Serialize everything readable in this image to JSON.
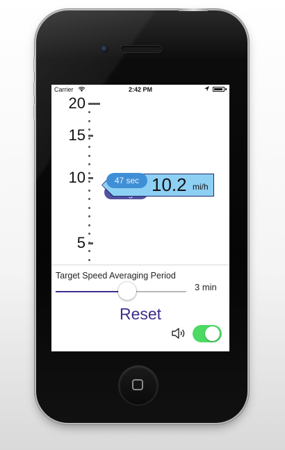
{
  "status_bar": {
    "carrier": "Carrier",
    "time": "2:42 PM",
    "battery_level": 0.9
  },
  "gauge": {
    "ticks": [
      "20",
      "15",
      "10",
      "5"
    ],
    "current_speed": "10.2",
    "speed_unit": "mi/h",
    "elapsed": "47 sec",
    "avg_label": "avg"
  },
  "settings": {
    "period_label": "Target Speed Averaging Period",
    "period_value": "3 min",
    "slider_level": 0.55,
    "reset_label": "Reset",
    "sound_enabled": true
  },
  "colors": {
    "accent": "#3c2f8c",
    "speed_box": "#8ed0f4",
    "sec_pill": "#3f8fd6",
    "avg_pill": "#5552a0",
    "toggle_on": "#4cd964"
  },
  "icons": {
    "wifi": "wifi-icon",
    "location": "location-arrow-icon",
    "battery": "battery-icon",
    "speaker": "speaker-icon"
  }
}
